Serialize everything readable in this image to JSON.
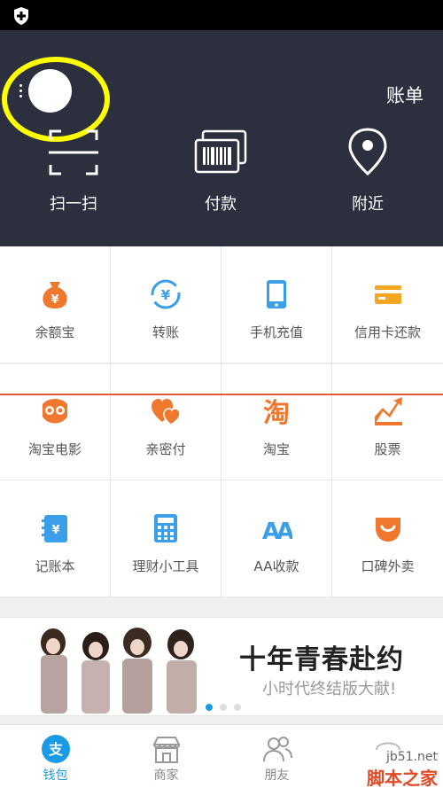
{
  "header": {
    "bill_label": "账单",
    "quick_actions": [
      {
        "label": "扫一扫",
        "icon": "scan-icon"
      },
      {
        "label": "付款",
        "icon": "barcode-pay-icon"
      },
      {
        "label": "附近",
        "icon": "location-pin-icon"
      }
    ]
  },
  "grid": {
    "items": [
      {
        "label": "余额宝",
        "icon": "money-bag-icon",
        "color": "#f0782e"
      },
      {
        "label": "转账",
        "icon": "transfer-icon",
        "color": "#3a9ee8"
      },
      {
        "label": "手机充值",
        "icon": "phone-icon",
        "color": "#3a9ee8"
      },
      {
        "label": "信用卡还款",
        "icon": "credit-card-icon",
        "color": "#f5a623"
      },
      {
        "label": "淘宝电影",
        "icon": "movie-glasses-icon",
        "color": "#f0782e"
      },
      {
        "label": "亲密付",
        "icon": "hearts-icon",
        "color": "#f0782e"
      },
      {
        "label": "淘宝",
        "icon": "taobao-icon",
        "color": "#f0782e"
      },
      {
        "label": "股票",
        "icon": "stock-chart-icon",
        "color": "#f0782e"
      },
      {
        "label": "记账本",
        "icon": "ledger-icon",
        "color": "#3a9ee8"
      },
      {
        "label": "理财小工具",
        "icon": "calculator-icon",
        "color": "#3a9ee8"
      },
      {
        "label": "AA收款",
        "icon": "aa-icon",
        "color": "#3a9ee8"
      },
      {
        "label": "口碑外卖",
        "icon": "koubei-icon",
        "color": "#f0782e"
      }
    ]
  },
  "banner": {
    "title": "十年青春赴约",
    "subtitle": "小时代终结版大献!",
    "page_count": 3,
    "active_page": 1
  },
  "bottom_nav": {
    "items": [
      {
        "label": "钱包",
        "icon": "wallet-icon",
        "active": true
      },
      {
        "label": "商家",
        "icon": "store-icon",
        "active": false
      },
      {
        "label": "朋友",
        "icon": "friends-icon",
        "active": false
      },
      {
        "label": "",
        "icon": "more-icon",
        "active": false
      }
    ]
  },
  "watermark": {
    "line1": "jb51.net",
    "line2": "脚本之家"
  },
  "colors": {
    "header_bg": "#2b2f3e",
    "accent_blue": "#1a9be8",
    "accent_orange": "#f0782e",
    "highlight_ring": "#ffff00"
  }
}
